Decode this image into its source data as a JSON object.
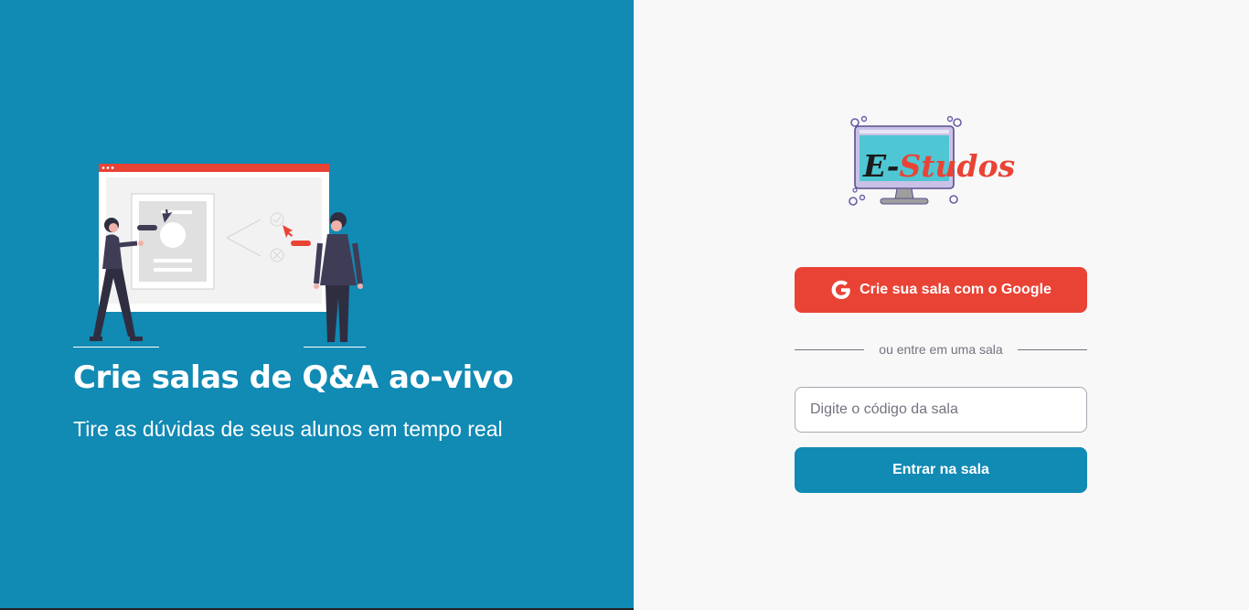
{
  "aside": {
    "title": "Crie salas de Q&A ao-vivo",
    "subtitle": "Tire as dúvidas de seus alunos em tempo real",
    "illustration_icon": "qa-illustration",
    "background": "#118ab4"
  },
  "main": {
    "logo": {
      "text": "E-Studos",
      "icon": "monitor-logo-icon"
    },
    "google_button": {
      "label": "Crie sua sala com o Google",
      "icon": "google-icon",
      "color": "#e94335"
    },
    "separator": "ou entre em uma sala",
    "room_input": {
      "placeholder": "Digite o código da sala",
      "value": ""
    },
    "enter_button": {
      "label": "Entrar na sala",
      "color": "#118ab4"
    }
  }
}
